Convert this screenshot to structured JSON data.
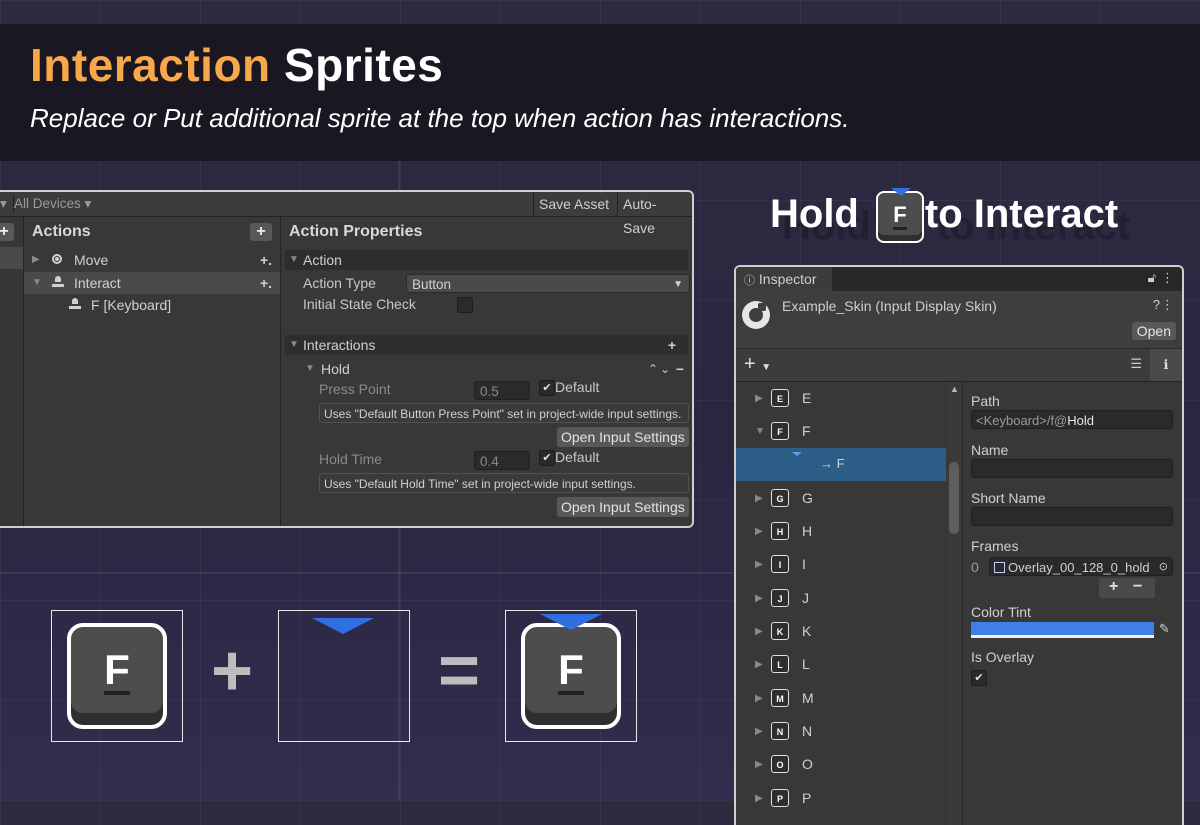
{
  "banner": {
    "title_accent": "Interaction",
    "title_rest": "Sprites",
    "subtitle": "Replace or Put additional sprite at the top when action has interactions."
  },
  "action_window": {
    "toolbar": {
      "devices_dropdown": "All Devices",
      "save_asset": "Save Asset",
      "auto_save": "Auto-Save"
    },
    "actions_header": "Actions",
    "actions": [
      {
        "label": "Move",
        "icon": "radio-dot-icon"
      },
      {
        "label": "Interact",
        "icon": "button-action-icon"
      },
      {
        "label": "F [Keyboard]",
        "icon": "binding-icon"
      }
    ],
    "properties_header": "Action Properties",
    "action_section": "Action",
    "action_type_label": "Action Type",
    "action_type_value": "Button",
    "initial_state_label": "Initial State Check",
    "interactions_section": "Interactions",
    "hold_label": "Hold",
    "press_point_label": "Press Point",
    "press_point_value": "0.5",
    "default_label": "Default",
    "press_help": "Uses \"Default Button Press Point\" set in project-wide input settings.",
    "open_settings": "Open Input Settings",
    "hold_time_label": "Hold Time",
    "hold_time_value": "0.4",
    "hold_help": "Uses \"Default Hold Time\" set in project-wide input settings."
  },
  "hold_caption": {
    "before": "Hold",
    "key": "F",
    "after": "to Interact"
  },
  "inspector": {
    "tab": "Inspector",
    "object_name": "Example_Skin (Input Display Skin)",
    "open_button": "Open",
    "list_items": [
      {
        "key": "E",
        "name": "E",
        "expanded": false
      },
      {
        "key": "F",
        "name": "F",
        "expanded": true
      },
      {
        "key": "",
        "name": "→ F",
        "selected": true
      },
      {
        "key": "G",
        "name": "G",
        "expanded": false
      },
      {
        "key": "H",
        "name": "H",
        "expanded": false
      },
      {
        "key": "I",
        "name": "I",
        "expanded": false
      },
      {
        "key": "J",
        "name": "J",
        "expanded": false
      },
      {
        "key": "K",
        "name": "K",
        "expanded": false
      },
      {
        "key": "L",
        "name": "L",
        "expanded": false
      },
      {
        "key": "M",
        "name": "M",
        "expanded": false
      },
      {
        "key": "N",
        "name": "N",
        "expanded": false
      },
      {
        "key": "O",
        "name": "O",
        "expanded": false
      },
      {
        "key": "P",
        "name": "P",
        "expanded": false
      }
    ],
    "path_label": "Path",
    "path_value_prefix": "<Keyboard>/f@",
    "path_value_suffix": "Hold",
    "name_label": "Name",
    "short_name_label": "Short Name",
    "frames_label": "Frames",
    "frame_index": "0",
    "frame_value": "Overlay_00_128_0_hold",
    "color_tint_label": "Color Tint",
    "color_tint": "#3f7fe6",
    "is_overlay_label": "Is Overlay"
  },
  "formula": {
    "key_letter": "F",
    "plus": "+",
    "equals": "="
  },
  "colors": {
    "accent": "#f7a94a",
    "blue": "#2f6fe0"
  }
}
